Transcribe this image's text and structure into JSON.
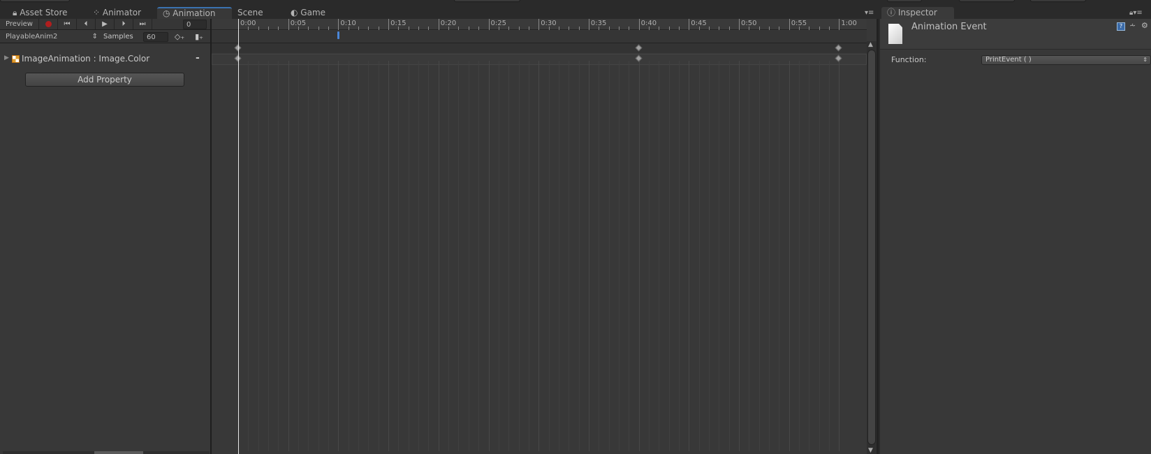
{
  "tabs": [
    {
      "label": "Asset Store",
      "icon": "asset-store-icon"
    },
    {
      "label": "Animator",
      "icon": "animator-icon"
    },
    {
      "label": "Animation",
      "icon": "clock-icon",
      "active": true
    },
    {
      "label": "Scene"
    },
    {
      "label": "Game",
      "icon": "pacman-icon"
    }
  ],
  "toolbar": {
    "preview": "Preview",
    "frame": "0",
    "clip": "PlayableAnim2",
    "samples_label": "Samples",
    "samples": "60"
  },
  "properties": [
    {
      "label": "ImageAnimation : Image.Color",
      "remove": "-"
    }
  ],
  "add_property": "Add Property",
  "timeline": {
    "labels": [
      "0:00",
      "0:05",
      "0:10",
      "0:15",
      "0:20",
      "0:25",
      "0:30",
      "0:35",
      "0:40",
      "0:45",
      "0:50",
      "0:55",
      "1:00"
    ],
    "keyframes": [
      "0:00",
      "0:40",
      "1:00"
    ],
    "event": "0:10",
    "playhead": "0:00"
  },
  "inspector": {
    "tab": "Inspector",
    "title": "Animation Event",
    "function_label": "Function:",
    "function_value": "PrintEvent ( )"
  },
  "colors": {
    "accent": "#3a72b0",
    "record": "#b01e1e",
    "event_marker": "#4a86d8"
  }
}
